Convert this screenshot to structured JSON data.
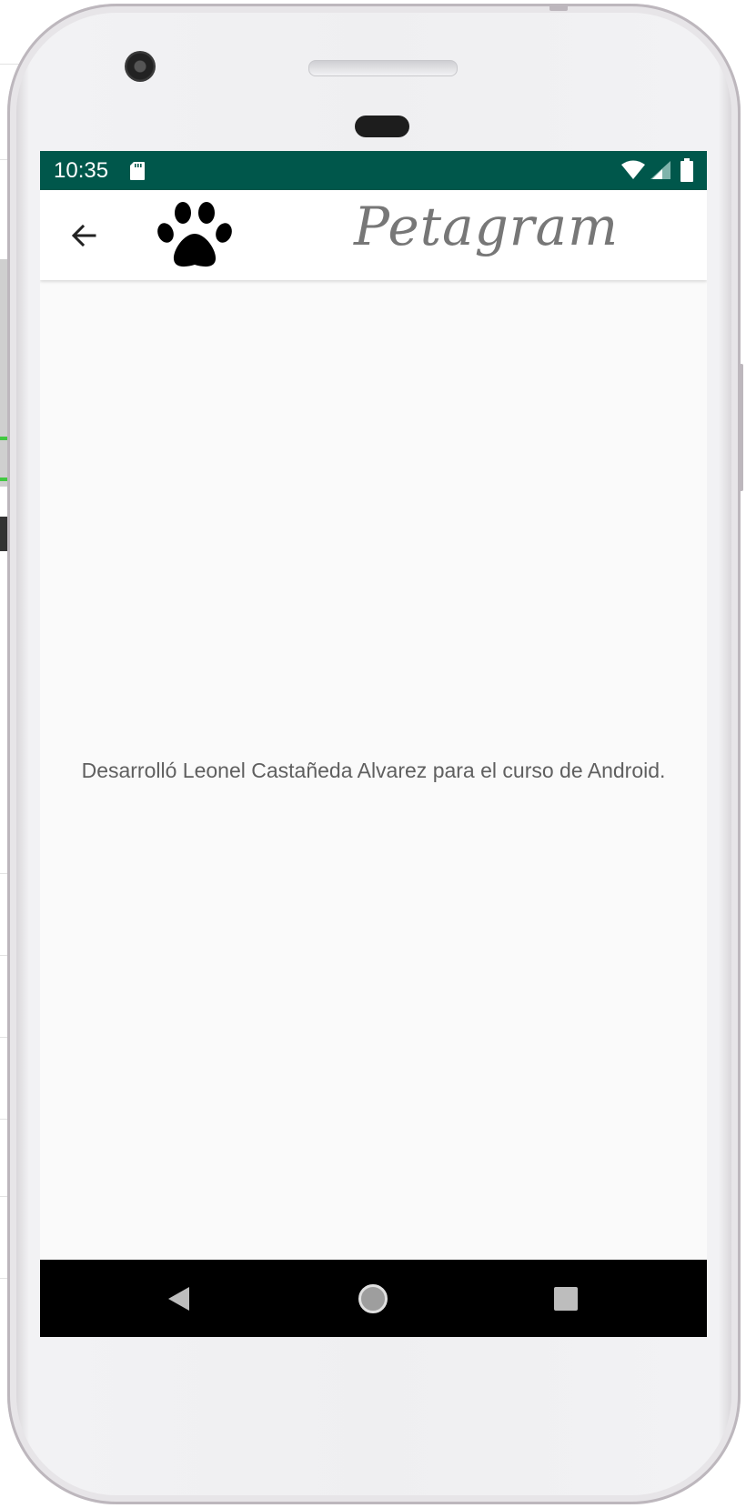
{
  "status_bar": {
    "time": "10:35",
    "background_color": "#00574b",
    "icons": [
      "sd-card-icon",
      "wifi-icon",
      "cell-signal-icon",
      "battery-icon"
    ]
  },
  "app_bar": {
    "back_icon": "arrow-back-icon",
    "logo_icon": "paw-icon",
    "title": "Petagram"
  },
  "content": {
    "message": "Desarrolló Leonel Castañeda Alvarez para el curso de Android."
  },
  "nav_bar": {
    "icons": [
      "nav-back-icon",
      "nav-home-icon",
      "nav-recents-icon"
    ]
  }
}
